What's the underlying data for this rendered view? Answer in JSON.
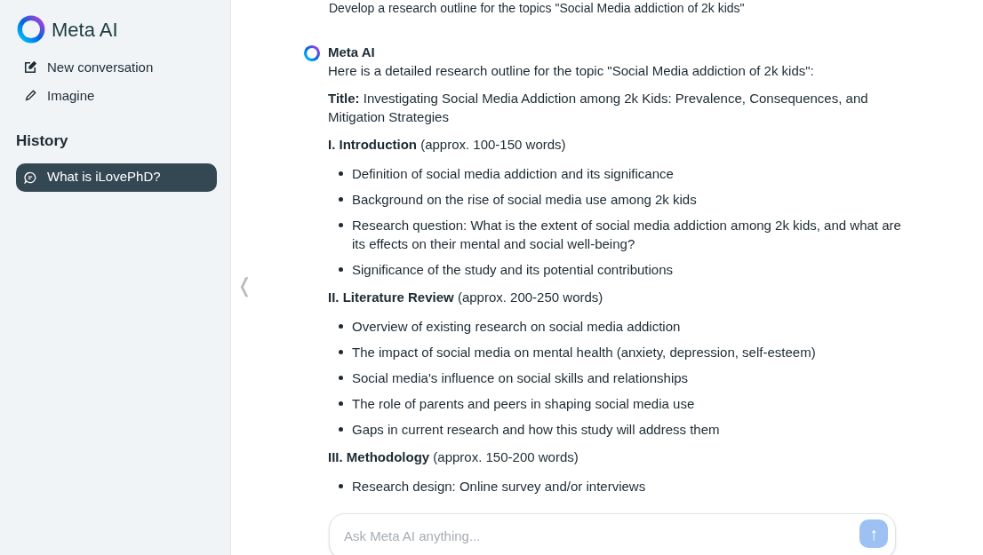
{
  "sidebar": {
    "brand": "Meta AI",
    "actions": [
      {
        "kind": "compose",
        "label": "New conversation"
      },
      {
        "kind": "brush",
        "label": "Imagine"
      }
    ],
    "history_title": "History",
    "history": [
      {
        "label": "What is iLovePhD?",
        "selected": true
      }
    ]
  },
  "collapse_glyph": "❬",
  "conversation": {
    "user_message": "Develop a research outline for the topics \"Social Media addiction of 2k kids\"",
    "assistant_name": "Meta AI",
    "intro": "Here is a detailed research outline for the topic \"Social Media addiction of 2k kids\":",
    "title": "**Title:** Investigating Social Media Addiction among 2k Kids: Prevalence, Consequences, and Mitigation Strategies",
    "sections": [
      {
        "heading": "**I. Introduction** (approx. 100-150 words)",
        "bullets": [
          "Definition of social media addiction and its significance",
          "Background on the rise of social media use among 2k kids",
          "Research question: What is the extent of social media addiction among 2k kids, and what are its effects on their mental and social well-being?",
          "Significance of the study and its potential contributions"
        ]
      },
      {
        "heading": "**II. Literature Review** (approx. 200-250 words)",
        "bullets": [
          "Overview of existing research on social media addiction",
          "The impact of social media on mental health (anxiety, depression, self-esteem)",
          "Social media's influence on social skills and relationships",
          "The role of parents and peers in shaping social media use",
          "Gaps in current research and how this study will address them"
        ]
      },
      {
        "heading": "**III. Methodology** (approx. 150-200 words)",
        "bullets": [
          "Research design: Online survey and/or interviews"
        ]
      }
    ]
  },
  "composer": {
    "placeholder": "Ask Meta AI anything...",
    "send_glyph": "↑"
  }
}
